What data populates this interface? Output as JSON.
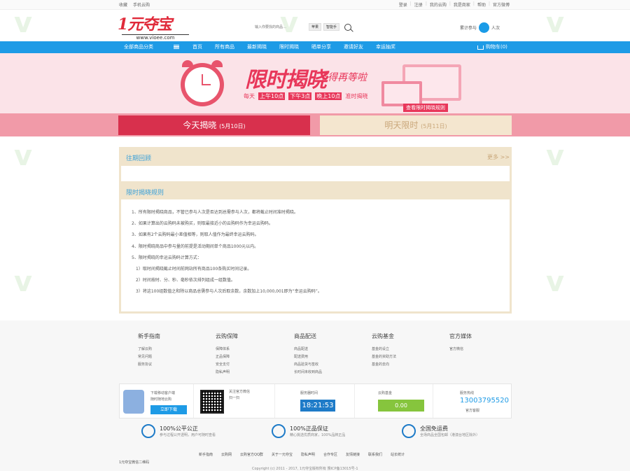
{
  "topbar": {
    "left": [
      "收藏",
      "手机云购"
    ],
    "right": [
      "登录",
      "注册",
      "我的云购",
      "我是商家",
      "帮助",
      "官方微博"
    ]
  },
  "header": {
    "logo_text": "1元夺宝",
    "logo_url": "www.vioee.com",
    "search_placeholder": "输入你要找的商品…",
    "search_tags": [
      "苹果",
      "智能手"
    ],
    "user_text": "累计参与",
    "user_count": "人次"
  },
  "nav": {
    "all_label": "全部商品分类",
    "items": [
      "首页",
      "所有商品",
      "最新揭晓",
      "限时揭晓",
      "晒单分享",
      "邀请好友",
      "幸运抽奖"
    ],
    "cart": "购物车(0)"
  },
  "banner": {
    "title": "限时揭晓",
    "subtitle": "不得再等啦",
    "times": [
      {
        "prefix": "每天",
        "time": "上午10点"
      },
      {
        "prefix": "",
        "time": "下午3点"
      },
      {
        "prefix": "",
        "time": "晚上10点"
      }
    ],
    "times_suffix": "准时揭晓",
    "button": "查看限时揭晓规则"
  },
  "tabs": {
    "today": {
      "label": "今天揭晓",
      "date": "(5月10日)"
    },
    "tomorrow": {
      "label": "明天限时",
      "date": "(5月11日)"
    }
  },
  "past": {
    "title": "往期回顾",
    "more": "更多 >>"
  },
  "rules": {
    "title": "限时揭晓规则",
    "lines": [
      "1、所有限时揭晓商品，不管已参与人次是否达到总需参与人次，都将截止时间准时揭晓。",
      "2、如果计算出的云购码未被购买，则取最接近小的云购码作为幸运云购码。",
      "3、如果有2个云购码最小差值相等，则取人值作为最终幸运云购码。",
      "4、限时揭晓商品中参与量的前提是活动期间单个商品1000元以内。",
      "5、限时揭晓的幸运云购码计算方式：",
      "1）取时间揭晓截止时间前网站所有商品100条购买时间记录。",
      "2）时间按时、分、秒、毫秒依次排列组成一组数值。",
      "3）将这100组数值之和除以商品总需参与人次后取余数，余数加上10,000,001即为“幸运云购码”。"
    ]
  },
  "footer": {
    "columns": [
      {
        "title": "新手指南",
        "items": [
          "了解云购",
          "常见问题",
          "服务协议"
        ]
      },
      {
        "title": "云购保障",
        "items": [
          "保障体系",
          "正品保障",
          "安全支付",
          "隐私声明"
        ]
      },
      {
        "title": "商品配送",
        "items": [
          "商品配送",
          "配送费用",
          "商品验货与签收",
          "长时间未收到商品"
        ]
      },
      {
        "title": "云购基金",
        "items": [
          "基金的设立",
          "基金的资助方法",
          "基金的去向"
        ]
      },
      {
        "title": "官方媒体",
        "items": [
          "官方微信"
        ]
      }
    ],
    "app_text": "下载移动客户端",
    "app_sub": "随时随地云购",
    "download_btn": "立即下载",
    "wechat_text": "关注官方微信",
    "wechat_sub": "扫一扫",
    "timer_label": "服务器时间",
    "timer_value": "18:21:53",
    "balance_label": "云购基金",
    "balance_value": "0.00",
    "service_label": "服务热线",
    "service_phone": "13003795520",
    "service_sub": "官方客服",
    "guarantees": [
      {
        "title": "100%公平公正",
        "sub": "参与过程公开透明，用户可随时查看"
      },
      {
        "title": "100%正品保证",
        "sub": "精心挑选优质商家，100%品牌正品"
      },
      {
        "title": "全国免运费",
        "sub": "全场商品全国包邮（港澳台地区除外）"
      }
    ],
    "links": [
      "新手指南",
      "云购网",
      "云购官方QQ群",
      "关于一元夺宝",
      "隐私声明",
      "合作专区",
      "友情链接",
      "联系我们",
      "站长统计"
    ],
    "left_link": "1元夺宝微信二维码",
    "copyright": "Copyright (c) 2011 - 2017, 1元夺宝版权所有 豫ICP备13015号-1"
  }
}
